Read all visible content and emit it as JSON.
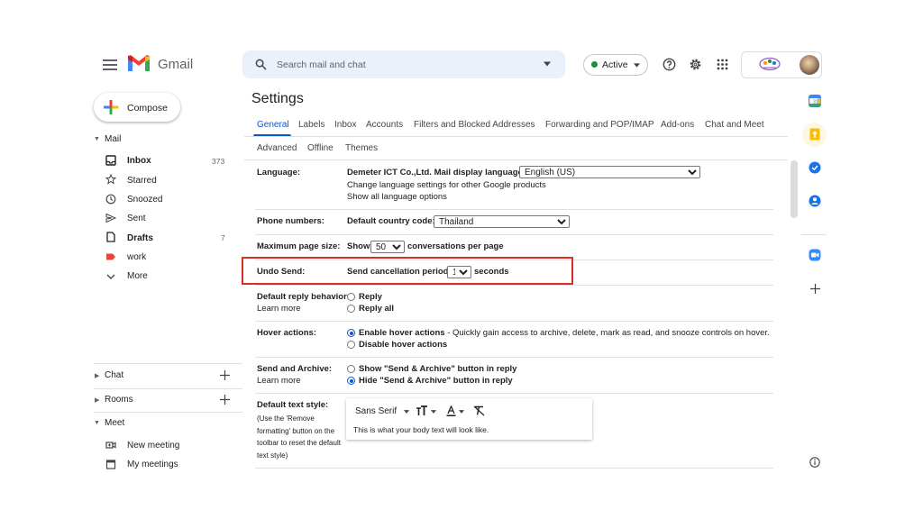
{
  "app": {
    "name": "Gmail"
  },
  "search": {
    "placeholder": "Search mail and chat"
  },
  "status": {
    "label": "Active",
    "color": "#1e8e3e"
  },
  "compose": {
    "label": "Compose"
  },
  "nav": {
    "mail_header": "Mail",
    "items": [
      {
        "label": "Inbox",
        "count": "373",
        "icon": "inbox-icon",
        "bold": true
      },
      {
        "label": "Starred",
        "count": "",
        "icon": "star-icon",
        "bold": false
      },
      {
        "label": "Snoozed",
        "count": "",
        "icon": "clock-icon",
        "bold": false
      },
      {
        "label": "Sent",
        "count": "",
        "icon": "send-icon",
        "bold": false
      },
      {
        "label": "Drafts",
        "count": "7",
        "icon": "draft-icon",
        "bold": true
      },
      {
        "label": "work",
        "count": "",
        "icon": "label-icon",
        "bold": false
      },
      {
        "label": "More",
        "count": "",
        "icon": "chevron-down-icon",
        "bold": false
      }
    ],
    "chat_header": "Chat",
    "rooms_header": "Rooms",
    "meet_header": "Meet",
    "meet_items": [
      {
        "label": "New meeting",
        "icon": "video-icon"
      },
      {
        "label": "My meetings",
        "icon": "calendar-icon"
      }
    ]
  },
  "settings": {
    "title": "Settings",
    "tabs": [
      "General",
      "Labels",
      "Inbox",
      "Accounts",
      "Filters and Blocked Addresses",
      "Forwarding and POP/IMAP",
      "Add-ons",
      "Chat and Meet"
    ],
    "tabs_row2": [
      "Advanced",
      "Offline",
      "Themes"
    ],
    "language": {
      "label": "Language:",
      "prefix": "Demeter ICT Co.,Ltd. Mail display language:",
      "value": "English (US)",
      "link1": "Change language settings for other Google products",
      "link2": "Show all language options"
    },
    "phone": {
      "label": "Phone numbers:",
      "prefix": "Default country code:",
      "value": "Thailand"
    },
    "page_size": {
      "label": "Maximum page size:",
      "prefix": "Show",
      "value": "50",
      "suffix": "conversations per page"
    },
    "undo_send": {
      "label": "Undo Send:",
      "prefix": "Send cancellation period:",
      "value": "10",
      "suffix": "seconds",
      "highlight_color": "#d93025"
    },
    "reply": {
      "label": "Default reply behavior:",
      "learn_more": "Learn more",
      "options": [
        "Reply",
        "Reply all"
      ],
      "selected": 0
    },
    "hover": {
      "label": "Hover actions:",
      "option1_bold": "Enable hover actions",
      "option1_rest": " - Quickly gain access to archive, delete, mark as read, and snooze controls on hover.",
      "option2": "Disable hover actions",
      "selected": 0
    },
    "send_archive": {
      "label": "Send and Archive:",
      "learn_more": "Learn more",
      "option1": "Show \"Send & Archive\" button in reply",
      "option2": "Hide \"Send & Archive\" button in reply",
      "selected": 1
    },
    "text_style": {
      "label": "Default text style:",
      "note_lines": [
        "(Use the 'Remove",
        "formatting' button on the",
        "toolbar to reset the default",
        "text style)"
      ],
      "font": "Sans Serif",
      "preview": "This is what your body text will look like."
    }
  },
  "colors": {
    "accent": "#0b57d0",
    "search_bg": "#eaf1fb"
  }
}
